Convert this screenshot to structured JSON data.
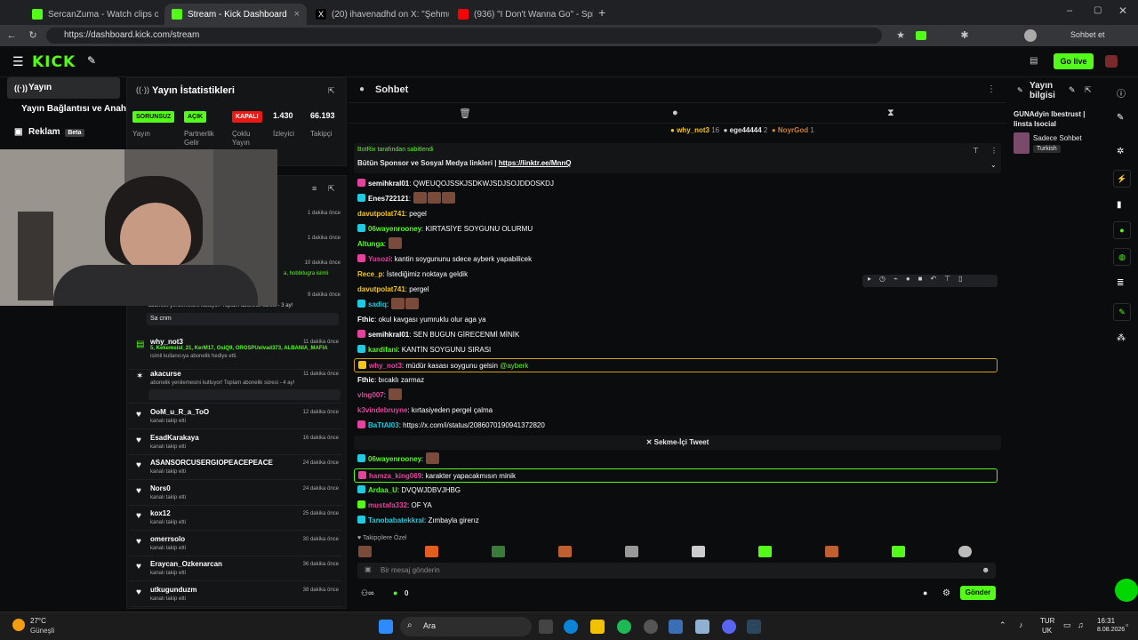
{
  "browser": {
    "tabs": [
      {
        "title": "SercanZuma - Watch clips on Kick",
        "color": "#53fc18"
      },
      {
        "title": "Stream - Kick Dashboard",
        "color": "#53fc18"
      },
      {
        "title": "(20) ihavenadhd on X: \"Şehmus &",
        "color": "#ffffff"
      },
      {
        "title": "(936) \"I Don't Wanna Go\" - Spider",
        "color": "#ff0000"
      }
    ],
    "url": "https://dashboard.kick.com/stream",
    "profile_label": "Sohbet et"
  },
  "header": {
    "logo": "KICK",
    "go_live": "Go live"
  },
  "nav": {
    "items": [
      "Yayın",
      "Yayın Bağlantısı ve Anahtarı",
      "Reklam"
    ],
    "beta": "Beta"
  },
  "stats": {
    "title": "Yayın İstatistikleri",
    "badges": [
      {
        "label": "SORUNSUZ",
        "caption": "Yayın",
        "color": "#53fc18"
      },
      {
        "label": "AÇIK",
        "caption": "Partnerlik Gelir",
        "color": "#53fc18"
      },
      {
        "label": "KAPALI",
        "caption": "Çoklu Yayın",
        "color": "#e91916"
      }
    ],
    "viewers": {
      "value": "1.430",
      "label": "İzleyici"
    },
    "followers": {
      "value": "66.193",
      "label": "Takipçi"
    }
  },
  "activity": {
    "top_times": [
      "1 dakika önce",
      "1 dakika önce",
      "10 dakika önce",
      "9 dakika önce"
    ],
    "partial_10": "a, hobbitugra isimli",
    "partial_9": "abonelik yenilemesini kutluyor! Toplam abonelik süresi - 3 ay!",
    "partial_msg": "Sa cnm",
    "gift": {
      "name": "why_not3",
      "time": "11 dakika önce",
      "names": "5, Kekemsisl_21, KerM17, OsiQ9, OROSPUelvad373, ALBANIA_MAFIA",
      "note": "isimli kullanıcıya abonelik hediye etti."
    },
    "resub": {
      "name": "akacurse",
      "time": "11 dakika önce",
      "note": "abonelik yenilemesini kutluyor! Toplam abonelik süresi - 4 ay!"
    },
    "follows": [
      {
        "name": "OoM_u_R_a_ToO",
        "time": "12 dakika önce"
      },
      {
        "name": "EsadKarakaya",
        "time": "16 dakika önce"
      },
      {
        "name": "ASANSORCUSERGIOPEACEPEACE",
        "time": "24 dakika önce"
      },
      {
        "name": "Nors0",
        "time": "24 dakika önce"
      },
      {
        "name": "kox12",
        "time": "25 dakika önce"
      },
      {
        "name": "omerrsolo",
        "time": "30 dakika önce"
      },
      {
        "name": "Eraycan_Ozkenarcan",
        "time": "36 dakika önce"
      },
      {
        "name": "utkugunduzm",
        "time": "38 dakika önce"
      }
    ],
    "follow_note": "kanalı takip etti"
  },
  "chat": {
    "title": "Sohbet",
    "leaders": [
      {
        "name": "why_not3",
        "n": "16"
      },
      {
        "name": "ege44444",
        "n": "2"
      },
      {
        "name": "NoyrGod",
        "n": "1"
      }
    ],
    "pinned_by": "BotRix tarafından sabitlendi",
    "pinned_text": "Bütün Sponsor ve Sosyal Medya linkleri |",
    "pinned_link": "https://linktr.ee/MnnQ",
    "messages": [
      {
        "user": "semihkral01",
        "color": "#ffffff",
        "text": "QWEUQOJSSKJSDKWJSDJSOJDDOSKDJ",
        "badge": "#e5429f"
      },
      {
        "user": "Enes722121",
        "color": "#ffffff",
        "text": "",
        "emotes": 3,
        "badge": "#1ecbe1"
      },
      {
        "user": "davutpolat741",
        "color": "#f5c518",
        "text": "pegel"
      },
      {
        "user": "06wayenrooney",
        "color": "#53fc18",
        "text": "KIRTASİYE SOYGUNU OLURMU",
        "badge": "#1ecbe1"
      },
      {
        "user": "Altunga",
        "color": "#53fc18",
        "text": "",
        "emotes": 1
      },
      {
        "user": "Yusozi",
        "color": "#e5429f",
        "text": "kantin soygununu sdece ayberk yapabilicek",
        "badge": "#e5429f"
      },
      {
        "user": "Rece_p",
        "color": "#f5c518",
        "text": "İstediğimiz noktaya geldik"
      },
      {
        "user": "davutpolat741",
        "color": "#f5c518",
        "text": "pergel"
      },
      {
        "user": "sadiq",
        "color": "#1ecbe1",
        "text": "",
        "emotes": 2,
        "badge": "#1ecbe1"
      },
      {
        "user": "Fthic",
        "color": "#ffffff",
        "text": "okul kavgası yumruklu olur aga ya"
      },
      {
        "user": "semihkral01",
        "color": "#ffffff",
        "text": "SEN BUGUN GİRECENMİ MİNİK",
        "badge": "#e5429f"
      },
      {
        "user": "kardifani",
        "color": "#53fc18",
        "text": "KANTİN SOYGUNU SIRASI",
        "badge": "#1ecbe1"
      },
      {
        "user": "why_not3",
        "color": "#e5429f",
        "text": "müdür kasası soygunu gelsin",
        "mention": "@ayberk",
        "highlight": "#d4a017",
        "badge": "#f5c518"
      },
      {
        "user": "Fthic",
        "color": "#ffffff",
        "text": "bıcaklı zarmaz"
      },
      {
        "user": "vlng007",
        "color": "#e5429f",
        "text": "",
        "emotes": 1
      },
      {
        "user": "k3vindebruyne",
        "color": "#e5429f",
        "text": "kırtasiyeden pergel çalma"
      },
      {
        "user": "BaTtAl03",
        "color": "#1ecbe1",
        "text": "https://x.com/i/status/2086070190941372820",
        "badge": "#e5429f"
      },
      {
        "user": "06wayenrooney",
        "color": "#53fc18",
        "text": "",
        "emotes": 1,
        "badge": "#1ecbe1"
      },
      {
        "user": "hamza_king069",
        "color": "#e5429f",
        "text": "karakter yapacakmısın minik",
        "highlight": "#53fc18",
        "badge": "#e5429f"
      },
      {
        "user": "Ardaa_U",
        "color": "#53fc18",
        "text": "DVQWJDBVJHBG",
        "badge": "#1ecbe1"
      },
      {
        "user": "mustafa332",
        "color": "#e5429f",
        "text": "OF YA",
        "badge": "#53fc18"
      },
      {
        "user": "Tanobabatekkral",
        "color": "#1ecbe1",
        "text": "Zımbayla girerız",
        "badge": "#1ecbe1"
      }
    ],
    "tweet_label": "Sekme-İçi Tweet",
    "followers_special": "Takipçilere Özel",
    "input_placeholder": "Bir mesaj gönderin",
    "send": "Gönder",
    "count": "0"
  },
  "info": {
    "title": "Yayın bilgisi",
    "stream_title": "GUNAdyin Ibestrust | Iinsta Isocial",
    "category": "Sadece Sohbet",
    "tag": "Turkish"
  },
  "taskbar": {
    "weather_temp": "27°C",
    "weather_desc": "Güneşli",
    "search": "Ara",
    "lang": "TUR",
    "lang2": "UK",
    "time": "16:31",
    "date": "8.08.2026"
  }
}
